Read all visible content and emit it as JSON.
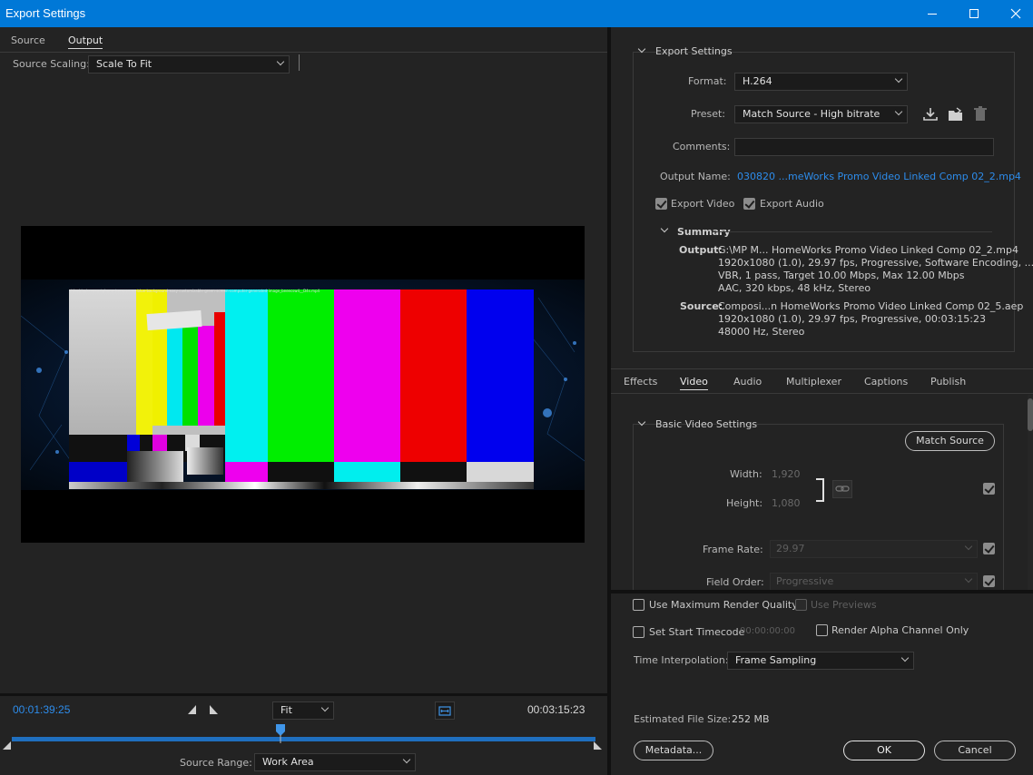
{
  "window": {
    "title": "Export Settings"
  },
  "left": {
    "tabs": [
      "Source",
      "Output"
    ],
    "active_tab": "Output",
    "source_scaling_label": "Source Scaling:",
    "source_scaling_value": "Scale To Fit",
    "preview_caption": "videoblocks-smartphone-turns-on-on-blue-background-easy-customizable-green-screen-computer-generated-image_beeecsw4__D4s.mp4"
  },
  "timeline": {
    "current_time": "00:01:39:25",
    "end_time": "00:03:15:23",
    "zoom": "Fit",
    "source_range_label": "Source Range:",
    "source_range_value": "Work Area",
    "playhead_fraction": 0.46
  },
  "export_settings": {
    "section_title": "Export Settings",
    "format_label": "Format:",
    "format_value": "H.264",
    "preset_label": "Preset:",
    "preset_value": "Match Source - High bitrate",
    "comments_label": "Comments:",
    "comments_value": "",
    "output_name_label": "Output Name:",
    "output_name_value": "030820 ...meWorks Promo Video Linked Comp 02_2.mp4",
    "export_video_label": "Export Video",
    "export_audio_label": "Export Audio",
    "summary_title": "Summary",
    "summary_output_label": "Output:",
    "summary_output_lines": [
      "G:\\MP M... HomeWorks Promo Video Linked Comp 02_2.mp4",
      "1920x1080 (1.0), 29.97 fps, Progressive, Software Encoding, ...",
      "VBR, 1 pass, Target 10.00 Mbps, Max 12.00 Mbps",
      "AAC, 320 kbps, 48 kHz, Stereo"
    ],
    "summary_source_label": "Source:",
    "summary_source_lines": [
      "Composi...n HomeWorks Promo Video Linked Comp 02_5.aep",
      "1920x1080 (1.0), 29.97 fps, Progressive, 00:03:15:23",
      "48000 Hz, Stereo"
    ]
  },
  "settings_tabs": [
    "Effects",
    "Video",
    "Audio",
    "Multiplexer",
    "Captions",
    "Publish"
  ],
  "active_settings_tab": "Video",
  "video": {
    "section_title": "Basic Video Settings",
    "match_source": "Match Source",
    "width_label": "Width:",
    "width_value": "1,920",
    "height_label": "Height:",
    "height_value": "1,080",
    "frame_rate_label": "Frame Rate:",
    "frame_rate_value": "29.97",
    "field_order_label": "Field Order:",
    "field_order_value": "Progressive"
  },
  "options": {
    "max_render_quality": "Use Maximum Render Quality",
    "use_previews": "Use Previews",
    "set_start_timecode": "Set Start Timecode",
    "start_timecode_value": "00:00:00:00",
    "render_alpha": "Render Alpha Channel Only",
    "time_interp_label": "Time Interpolation:",
    "time_interp_value": "Frame Sampling",
    "est_size_label": "Estimated File Size:",
    "est_size_value": "252 MB"
  },
  "buttons": {
    "metadata": "Metadata...",
    "ok": "OK",
    "cancel": "Cancel"
  },
  "colors": {
    "accent_blue": "#2d8ceb",
    "titlebar": "#0078d7"
  }
}
